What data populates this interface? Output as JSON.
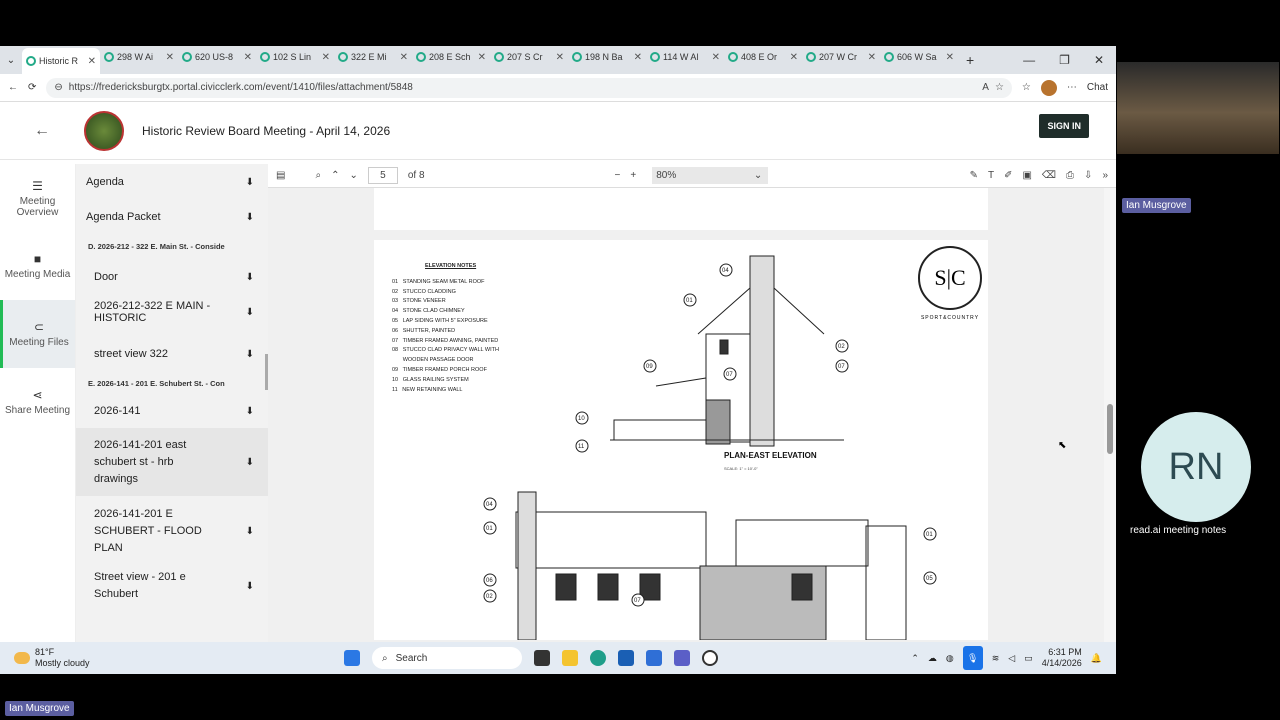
{
  "browser": {
    "tabs": [
      {
        "label": "Historic R",
        "active": true
      },
      {
        "label": "298 W Ai"
      },
      {
        "label": "620 US-8"
      },
      {
        "label": "102 S Lin"
      },
      {
        "label": "322 E Mi"
      },
      {
        "label": "208 E Sch"
      },
      {
        "label": "207 S Cr"
      },
      {
        "label": "198 N Ba"
      },
      {
        "label": "114 W Al"
      },
      {
        "label": "408 E Or"
      },
      {
        "label": "207 W Cr"
      },
      {
        "label": "606 W Sa"
      }
    ],
    "url": "https://fredericksburgtx.portal.civicclerk.com/event/1410/files/attachment/5848",
    "chat_label": "Chat"
  },
  "app": {
    "title": "Historic Review Board Meeting - April 14, 2026",
    "signin": "SIGN IN",
    "nav": [
      {
        "label": "Meeting Overview",
        "icon": "list-icon"
      },
      {
        "label": "Meeting Media",
        "icon": "video-icon"
      },
      {
        "label": "Meeting Files",
        "icon": "paperclip-icon",
        "active": true
      },
      {
        "label": "Share Meeting",
        "icon": "share-icon"
      }
    ],
    "files": {
      "agenda": "Agenda",
      "agenda_packet": "Agenda Packet",
      "section_d": "D. 2026-212 - 322 E. Main St. - Conside",
      "d_items": [
        "Door",
        "2026-212-322 E MAIN - HISTORIC",
        "street view 322"
      ],
      "section_e": "E. 2026-141 - 201 E. Schubert St. - Con",
      "e_items": [
        "2026-141",
        "2026-141-201 east schubert st - hrb drawings",
        "2026-141-201 E SCHUBERT - FLOOD PLAN",
        "Street view - 201 e Schubert"
      ]
    }
  },
  "pdf": {
    "page": "5",
    "of": "of 8",
    "zoom": "80%",
    "notes_title": "ELEVATION NOTES",
    "notes": [
      "01   STANDING SEAM METAL ROOF",
      "02   STUCCO CLADDING",
      "03   STONE VENEER",
      "04   STONE CLAD CHIMNEY",
      "05   LAP SIDING WITH 5\" EXPOSURE",
      "06   SHUTTER, PAINTED",
      "07   TIMBER FRAMED AWNING, PAINTED",
      "08   STUCCO CLAD PRIVACY WALL WITH",
      "       WOODEN PASSAGE DOOR",
      "09   TIMBER FRAMED PORCH ROOF",
      "10   GLASS RAILING SYSTEM",
      "11   NEW RETAINING WALL"
    ],
    "logo_text": "S|C",
    "logo_sub": "SPORT&COUNTRY",
    "elevation_title": "PLAN-EAST ELEVATION",
    "scale": "SCALE:   1\" = 10'-0\"",
    "callouts": [
      "04",
      "01",
      "02",
      "07",
      "09",
      "07",
      "10",
      "11",
      "04",
      "01",
      "06",
      "02",
      "07",
      "01",
      "05"
    ]
  },
  "meeting": {
    "participant": "Ian Musgrove",
    "avatar_initials": "RN",
    "avatar_caption": "read.ai meeting notes"
  },
  "taskbar": {
    "temp": "81°F",
    "weather": "Mostly cloudy",
    "search": "Search",
    "time": "6:31 PM",
    "date": "4/14/2026"
  }
}
